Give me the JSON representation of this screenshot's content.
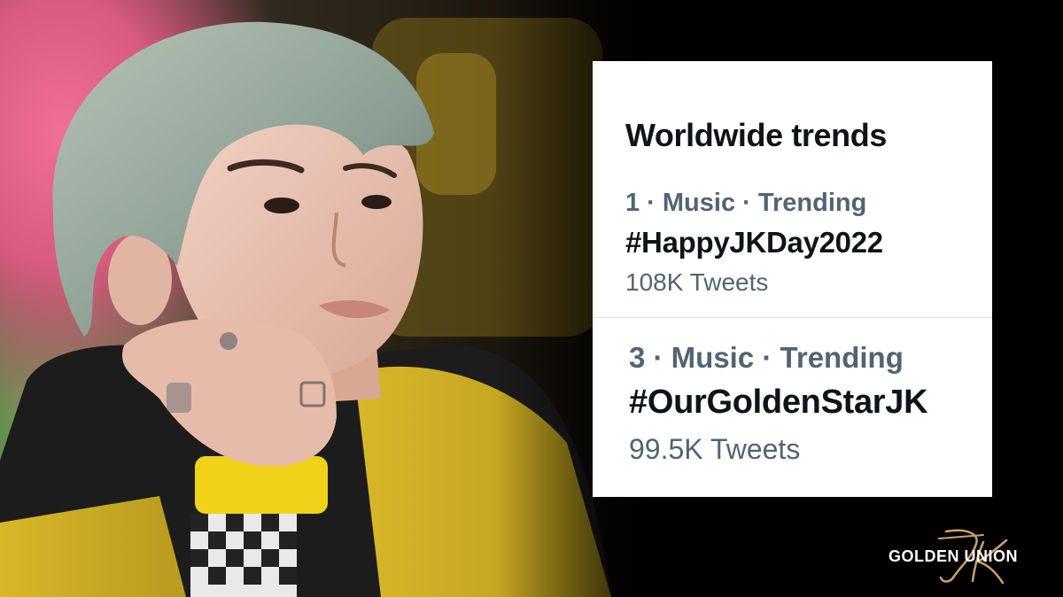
{
  "card": {
    "title": "Worldwide trends",
    "trends": [
      {
        "meta": "1 · Music · Trending",
        "hashtag": "#HappyJKDay2022",
        "tweets": "108K Tweets"
      },
      {
        "meta": "3 · Music · Trending",
        "hashtag": "#OurGoldenStarJK",
        "tweets": "99.5K Tweets"
      }
    ]
  },
  "watermark": {
    "text": "GOLDEN UNION",
    "monogram": "JK"
  },
  "colors": {
    "card_bg": "#ffffff",
    "title": "#0f1419",
    "secondary": "#536471",
    "divider": "#d9dde1",
    "monogram_gold": "#c9a36a",
    "backdrop": "#000000"
  }
}
